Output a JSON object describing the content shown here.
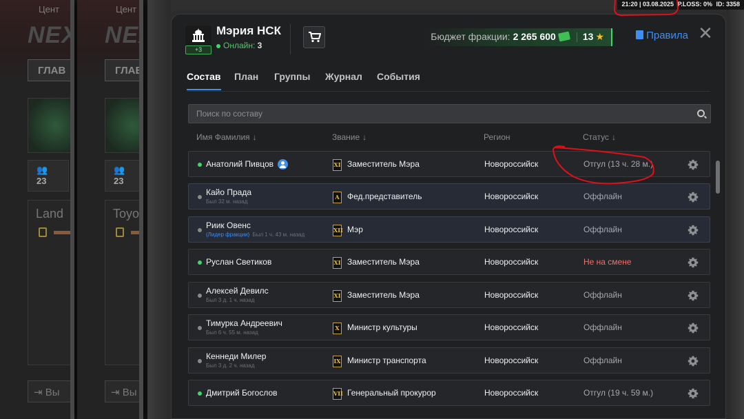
{
  "background": {
    "center_label": "Цент",
    "logo_text": "NEX",
    "tab_label": "ГЛАВ",
    "stat_value": "23",
    "card_title_1": "Land",
    "card_title_2": "Toyo",
    "exit_label": "Вы"
  },
  "hud": {
    "time": "21:20 | 03.08.2025",
    "ploss": "P.LOSS: 0%",
    "id": "ID: 3358"
  },
  "header": {
    "title": "Мэрия НСК",
    "online_label": "Онлайн:",
    "online_count": "3",
    "badge": "+3",
    "budget_label": "Бюджет фракции:",
    "budget_amount": "2 265 600",
    "stars": "13",
    "rules_label": "Правила",
    "close": "✕"
  },
  "tabs": [
    "Состав",
    "План",
    "Группы",
    "Журнал",
    "События"
  ],
  "search": {
    "placeholder": "Поиск по составу"
  },
  "columns": {
    "name": "Имя Фамилия",
    "rank": "Звание",
    "region": "Регион",
    "status": "Статус"
  },
  "members": [
    {
      "name": "Анатолий Пивцов",
      "sub": "",
      "leader": "",
      "online": true,
      "rank_icon": "XI",
      "rank": "Заместитель Мэра",
      "region": "Новороссийск",
      "status": "Отгул (13 ч. 28 м.)",
      "status_color": "grey"
    },
    {
      "name": "Кайо Прада",
      "sub": "Был 32 м. назад",
      "leader": "",
      "online": false,
      "rank_icon": "A",
      "rank": "Фед.представитель",
      "region": "Новороссийск",
      "status": "Оффлайн",
      "status_color": "grey"
    },
    {
      "name": "Риик Овенс",
      "sub": "Был 1 ч. 43 м. назад",
      "leader": "(Лидер фракции)",
      "online": false,
      "rank_icon": "XII",
      "rank": "Мэр",
      "region": "Новороссийск",
      "status": "Оффлайн",
      "status_color": "grey"
    },
    {
      "name": "Руслан Светиков",
      "sub": "",
      "leader": "",
      "online": true,
      "rank_icon": "XI",
      "rank": "Заместитель Мэра",
      "region": "Новороссийск",
      "status": "Не на смене",
      "status_color": "red"
    },
    {
      "name": "Алексей Девилс",
      "sub": "Был 3 д. 1 ч. назад",
      "leader": "",
      "online": false,
      "rank_icon": "XI",
      "rank": "Заместитель Мэра",
      "region": "Новороссийск",
      "status": "Оффлайн",
      "status_color": "grey"
    },
    {
      "name": "Тимурка Андреевич",
      "sub": "Был 6 ч. 55 м. назад",
      "leader": "",
      "online": false,
      "rank_icon": "X",
      "rank": "Министр культуры",
      "region": "Новороссийск",
      "status": "Оффлайн",
      "status_color": "grey"
    },
    {
      "name": "Кеннеди Милер",
      "sub": "Был 3 д. 2 ч. назад",
      "leader": "",
      "online": false,
      "rank_icon": "IX",
      "rank": "Министр транспорта",
      "region": "Новороссийск",
      "status": "Оффлайн",
      "status_color": "grey"
    },
    {
      "name": "Дмитрий Богослов",
      "sub": "",
      "leader": "",
      "online": true,
      "rank_icon": "VII",
      "rank": "Генеральный прокурор",
      "region": "Новороссийск",
      "status": "Отгул (19 ч. 59 м.)",
      "status_color": "grey"
    }
  ],
  "colors": {
    "accent_blue": "#3f8ff2",
    "online_green": "#3fd66a",
    "status_red": "#f0706b",
    "star_gold": "#f2c12e",
    "annotation_red": "#e0101a"
  }
}
